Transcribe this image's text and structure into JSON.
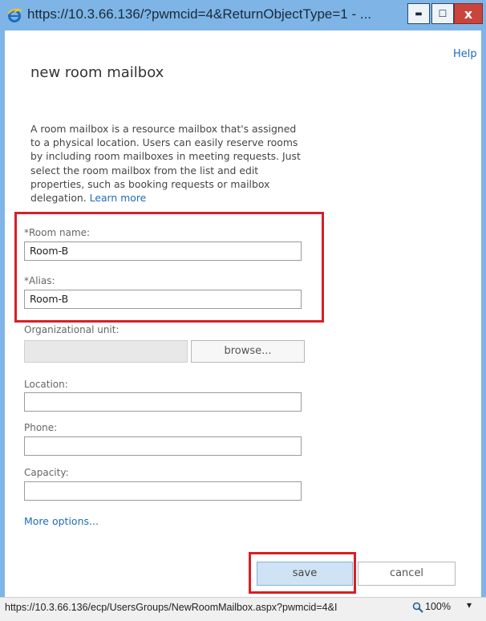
{
  "window": {
    "title": "https://10.3.66.136/?pwmcid=4&ReturnObjectType=1 - ...",
    "minimize_glyph": "▬",
    "maximize_glyph": "☐",
    "close_glyph": "x"
  },
  "dialog": {
    "help": "Help",
    "heading": "new room mailbox",
    "description": "A room mailbox is a resource mailbox that's assigned to a physical location. Users can easily reserve rooms by including room mailboxes in meeting requests. Just select the room mailbox from the list and edit properties, such as booking requests or mailbox delegation.",
    "learn_more": "Learn more"
  },
  "form": {
    "room_name": {
      "label": "*Room name:",
      "value": "Room-B"
    },
    "alias": {
      "label": "*Alias:",
      "value": "Room-B"
    },
    "org_unit": {
      "label": "Organizational unit:",
      "value": "",
      "browse": "browse..."
    },
    "location": {
      "label": "Location:",
      "value": ""
    },
    "phone": {
      "label": "Phone:",
      "value": ""
    },
    "capacity": {
      "label": "Capacity:",
      "value": ""
    },
    "more_options": "More options..."
  },
  "buttons": {
    "save": "save",
    "cancel": "cancel"
  },
  "statusbar": {
    "url": "https://10.3.66.136/ecp/UsersGroups/NewRoomMailbox.aspx?pwmcid=4&I",
    "zoom": "100%",
    "zoom_caret": "▾"
  },
  "colors": {
    "titlebar": "#7eb5e6",
    "link": "#1f6db8",
    "highlight": "#d81f26",
    "save_button": "#cfe3f4"
  },
  "icons": {
    "browser": "ie-icon",
    "zoom": "magnifier-icon"
  }
}
